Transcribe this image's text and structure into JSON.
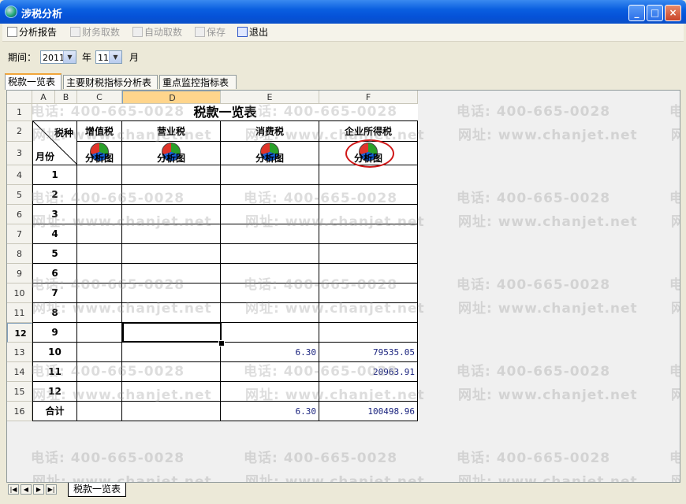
{
  "window": {
    "title": "涉税分析"
  },
  "toolbar": {
    "items": [
      {
        "label": "分析报告",
        "enabled": true
      },
      {
        "label": "财务取数",
        "enabled": false
      },
      {
        "label": "自动取数",
        "enabled": false
      },
      {
        "label": "保存",
        "enabled": false
      },
      {
        "label": "退出",
        "enabled": true
      }
    ]
  },
  "period": {
    "label": "期间：",
    "year": "2011",
    "year_unit": "年",
    "month": "11",
    "month_unit": "月"
  },
  "tabs": [
    "税款一览表",
    "主要财税指标分析表",
    "重点监控指标表"
  ],
  "sheet": {
    "columns": [
      "A",
      "B",
      "C",
      "D",
      "E",
      "F"
    ],
    "rows": [
      "1",
      "2",
      "3",
      "4",
      "5",
      "6",
      "7",
      "8",
      "9",
      "10",
      "11",
      "12",
      "13",
      "14",
      "15",
      "16"
    ],
    "selected_row": "12",
    "selected_column": "D",
    "title": "税款一览表",
    "corner_top": "税种",
    "corner_bottom": "月份",
    "tax_types": [
      "增值税",
      "营业税",
      "消费税",
      "企业所得税"
    ],
    "chart_label": "分析图",
    "months": [
      "1",
      "2",
      "3",
      "4",
      "5",
      "6",
      "7",
      "8",
      "9",
      "10",
      "11",
      "12"
    ],
    "total_label": "合计",
    "data": [
      {
        "month": "10",
        "consumption": "6.30",
        "income": "79535.05"
      },
      {
        "month": "11",
        "consumption": "",
        "income": "20963.91"
      }
    ],
    "total": {
      "consumption": "6.30",
      "income": "100498.96"
    }
  },
  "watermark": {
    "phone": "电话: 400-665-0028",
    "site": "网址: www.chanjet.net"
  },
  "sheet_tab": "税款一览表"
}
